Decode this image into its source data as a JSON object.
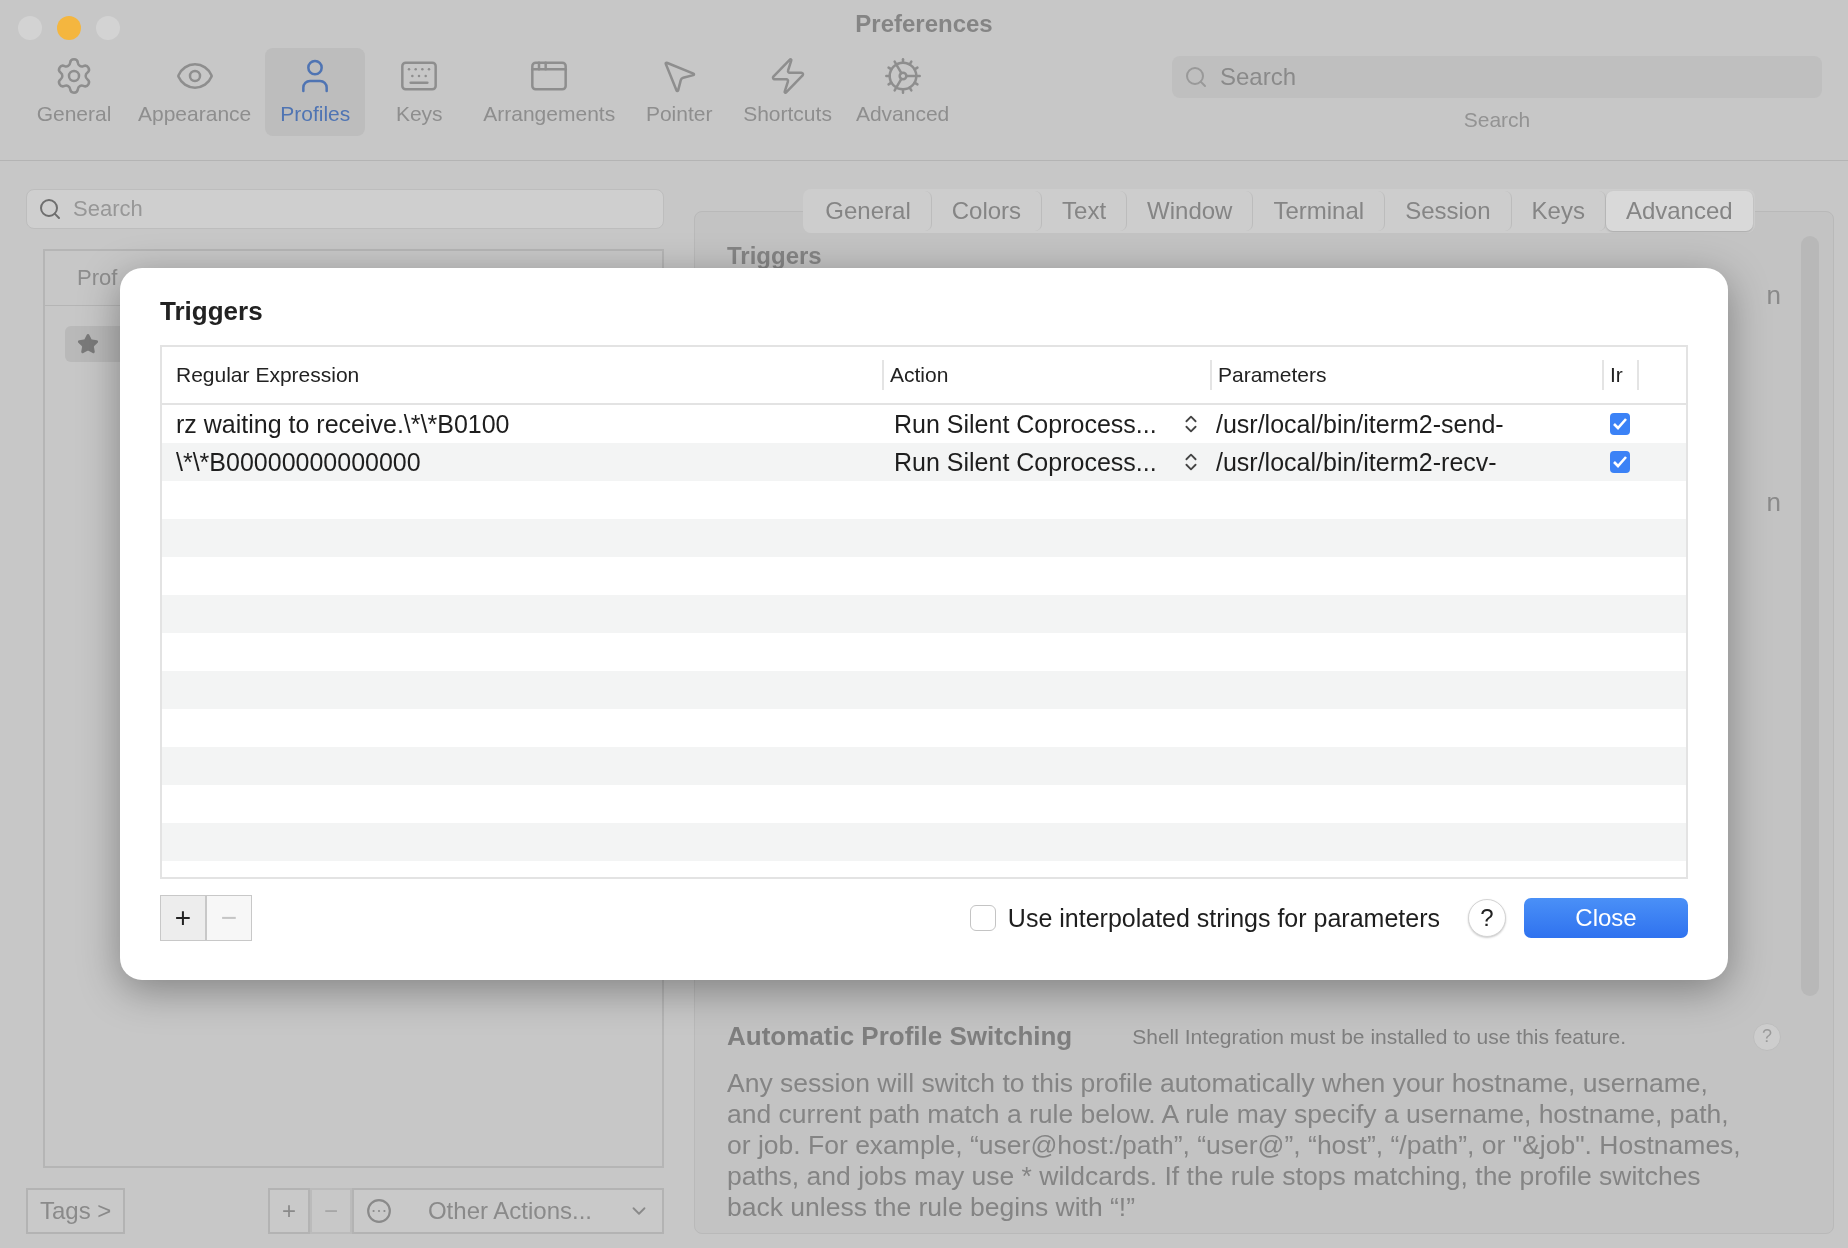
{
  "window": {
    "title": "Preferences"
  },
  "toolbar": {
    "items": [
      {
        "label": "General",
        "kind": "gear",
        "selected": false
      },
      {
        "label": "Appearance",
        "kind": "eye",
        "selected": false
      },
      {
        "label": "Profiles",
        "kind": "person",
        "selected": true
      },
      {
        "label": "Keys",
        "kind": "keyboard",
        "selected": false
      },
      {
        "label": "Arrangements",
        "kind": "window",
        "selected": false
      },
      {
        "label": "Pointer",
        "kind": "pointer",
        "selected": false
      },
      {
        "label": "Shortcuts",
        "kind": "bolt",
        "selected": false
      },
      {
        "label": "Advanced",
        "kind": "gears",
        "selected": false
      }
    ],
    "search": {
      "placeholder": "Search",
      "label": "Search"
    }
  },
  "profiles_panel": {
    "search": {
      "placeholder": "Search"
    },
    "column_header": "Prof",
    "tags_button": "Tags >",
    "add_button": "+",
    "remove_button": {
      "label": "−",
      "disabled": true
    },
    "other_actions": "Other Actions..."
  },
  "profile_tabs": [
    {
      "label": "General",
      "selected": false
    },
    {
      "label": "Colors",
      "selected": false
    },
    {
      "label": "Text",
      "selected": false
    },
    {
      "label": "Window",
      "selected": false
    },
    {
      "label": "Terminal",
      "selected": false
    },
    {
      "label": "Session",
      "selected": false
    },
    {
      "label": "Keys",
      "selected": false
    },
    {
      "label": "Advanced",
      "selected": true
    }
  ],
  "section_title": "Triggers",
  "fragments": [
    "n",
    "n"
  ],
  "dialog": {
    "title": "Triggers",
    "columns": [
      "Regular Expression",
      "Action",
      "Parameters",
      "Ir"
    ],
    "rows": [
      {
        "regex": "rz waiting to receive.\\*\\*B0100",
        "action": "Run Silent Coprocess...",
        "parameters": "/usr/local/bin/iterm2-send-",
        "checked": true
      },
      {
        "regex": "\\*\\*B00000000000000",
        "action": "Run Silent Coprocess...",
        "parameters": "/usr/local/bin/iterm2-recv-",
        "checked": true
      }
    ],
    "add_button": "+",
    "remove_button": {
      "label": "−",
      "disabled": true
    },
    "interpolated": {
      "label": "Use interpolated strings for parameters",
      "checked": false
    },
    "help": "?",
    "close": "Close"
  },
  "auto_switching": {
    "title": "Automatic Profile Switching",
    "note": "Shell Integration must be installed to use this feature.",
    "help": "?",
    "text": "Any session will switch to this profile automatically when your hostname, username, and current path match a rule below. A rule may specify a username, hostname, path, or job. For example, “user@host:/path”, “user@”, “host”, “/path”, or \"&job\". Hostnames, paths, and jobs may use * wildcards. If the rule stops matching, the profile switches back unless the rule begins with “!”"
  }
}
